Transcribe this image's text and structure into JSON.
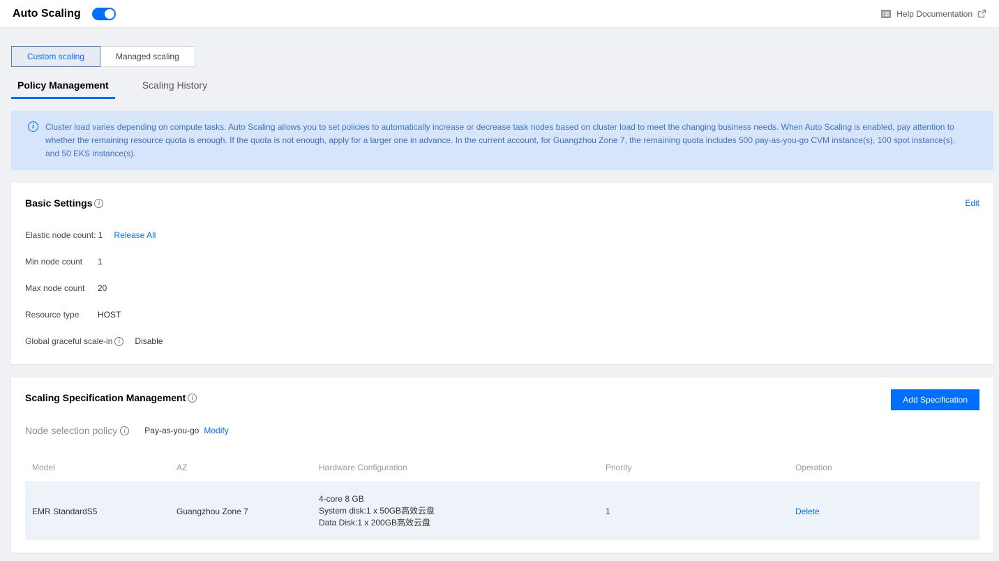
{
  "colors": {
    "accent": "#006eff",
    "banner_bg": "#d6e5fa",
    "banner_text": "#4270c4",
    "page_bg": "#eff1f5",
    "table_row_bg": "#eef3f9"
  },
  "icons": {
    "info_glyph": "i",
    "help": "documentation-icon",
    "external": "external-link-icon"
  },
  "header": {
    "title": "Auto Scaling",
    "toggle_state": "on",
    "help_label": "Help Documentation"
  },
  "tabs": [
    {
      "label": "Custom scaling",
      "selected": true
    },
    {
      "label": "Managed scaling",
      "selected": false
    }
  ],
  "subtabs": [
    {
      "label": "Policy Management",
      "selected": true
    },
    {
      "label": "Scaling History",
      "selected": false
    }
  ],
  "banner": {
    "text": "Cluster load varies depending on compute tasks. Auto Scaling allows you to set policies to automatically increase or decrease task nodes based on cluster load to meet the changing business needs. When Auto Scaling is enabled, pay attention to whether the remaining resource quota is enough. If the quota is not enough, apply for a larger one in advance. In the current account, for Guangzhou Zone 7, the remaining quota includes 500 pay-as-you-go CVM instance(s), 100 spot instance(s), and 50 EKS instance(s)."
  },
  "basic_settings": {
    "title": "Basic Settings",
    "edit_label": "Edit",
    "elastic": {
      "label": "Elastic node count: 1",
      "release_label": "Release All"
    },
    "fields": [
      {
        "label": "Min node count",
        "value": "1"
      },
      {
        "label": "Max node count",
        "value": "20"
      },
      {
        "label": "Resource type",
        "value": "HOST"
      },
      {
        "label": "Global graceful scale-in",
        "value": "Disable"
      }
    ]
  },
  "spec": {
    "title": "Scaling Specification Management",
    "add_button_label": "Add Specification",
    "node_policy_label": "Node selection policy",
    "node_policy_value": "Pay-as-you-go",
    "modify_label": "Modify",
    "table": {
      "columns": [
        "Model",
        "AZ",
        "Hardware Configuration",
        "Priority",
        "Operation"
      ],
      "row": {
        "model": "EMR StandardS5",
        "az": "Guangzhou Zone 7",
        "hardware_lines": [
          "4-core 8 GB",
          "System disk:1 x 50GB高效云盘",
          "Data Disk:1 x 200GB高效云盘"
        ],
        "priority": "1",
        "operation": "Delete"
      }
    }
  }
}
